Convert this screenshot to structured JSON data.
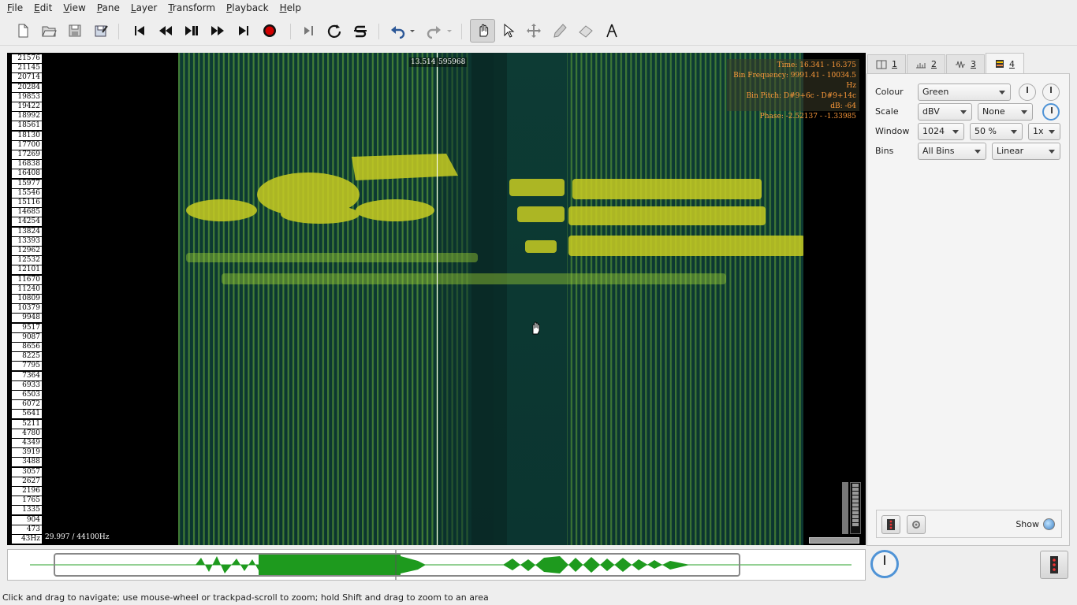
{
  "menu": [
    "File",
    "Edit",
    "View",
    "Pane",
    "Layer",
    "Transform",
    "Playback",
    "Help"
  ],
  "menu_underline": [
    "F",
    "E",
    "V",
    "P",
    "L",
    "T",
    "P",
    "H"
  ],
  "toolbar": {
    "icons": [
      "new-file-icon",
      "open-icon",
      "save-icon",
      "save-as-icon",
      "rewind-start-icon",
      "rewind-icon",
      "play-pause-icon",
      "fast-forward-icon",
      "forward-end-icon",
      "record-icon",
      "play-selection-icon",
      "loop-icon",
      "solo-icon",
      "undo-icon",
      "redo-icon",
      "navigate-tool-icon",
      "select-tool-icon",
      "move-tool-icon",
      "draw-tool-icon",
      "erase-tool-icon",
      "measure-tool-icon"
    ]
  },
  "frequency_scale": [
    "21576",
    "21145",
    "20714",
    "20284",
    "19853",
    "19422",
    "18992",
    "18561",
    "18130",
    "17700",
    "17269",
    "16838",
    "16408",
    "15977",
    "15546",
    "15116",
    "14685",
    "14254",
    "13824",
    "13393",
    "12962",
    "12532",
    "12101",
    "11670",
    "11240",
    "10809",
    "10379",
    "9948",
    "9517",
    "9087",
    "8656",
    "8225",
    "7795",
    "7364",
    "6933",
    "6503",
    "6072",
    "5641",
    "5211",
    "4780",
    "4349",
    "3919",
    "3488",
    "3057",
    "2627",
    "2196",
    "1765",
    "1335",
    "904",
    "473",
    "43Hz"
  ],
  "pane": {
    "mark_time": "13.514",
    "mark_frame": "595968",
    "info": {
      "time": "Time: 16.341 - 16.375",
      "bin_frequency": "Bin Frequency: 9991.41 - 10034.5 Hz",
      "bin_pitch": "Bin Pitch: D#9+6c - D#9+14c",
      "db": "dB: -64",
      "phase": "Phase: -2.52137 - -1.33985"
    },
    "duration_label": "29.997 / 44100Hz",
    "spectrogram_color": "#9acd32"
  },
  "tabs": [
    {
      "num": "1",
      "icon": "pane-icon"
    },
    {
      "num": "2",
      "icon": "ruler-icon"
    },
    {
      "num": "3",
      "icon": "waveform-icon"
    },
    {
      "num": "4",
      "icon": "spectrogram-icon"
    }
  ],
  "properties": {
    "colour_label": "Colour",
    "colour_value": "Green",
    "scale_label": "Scale",
    "scale_value": "dBV",
    "scale_norm": "None",
    "window_label": "Window",
    "window_size": "1024",
    "window_overlap": "50 %",
    "window_oversample": "1x",
    "bins_label": "Bins",
    "bins_value": "All Bins",
    "bins_scale": "Linear"
  },
  "layer": {
    "show_label": "Show"
  },
  "status_text": "Click and drag to navigate; use mouse-wheel or trackpad-scroll to zoom; hold Shift and drag to zoom to an area"
}
